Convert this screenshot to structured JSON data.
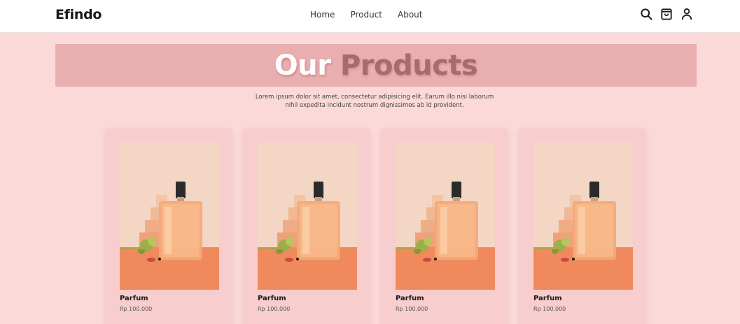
{
  "brand": {
    "name": "Efindo"
  },
  "nav": {
    "links": [
      {
        "label": "Home"
      },
      {
        "label": "Product"
      },
      {
        "label": "About"
      }
    ],
    "icons": [
      "search-icon",
      "bag-icon",
      "user-icon"
    ]
  },
  "hero": {
    "title_part1": "Our",
    "title_part2": "Products",
    "description_line1": "Lorem ipsum dolor sit amet, consectetur adipisicing elit. Earum illo nisi laborum",
    "description_line2": "nihil expedita incidunt nostrum dignissimos ab id provident."
  },
  "products": [
    {
      "name": "Parfum",
      "price": "Rp 100.000"
    },
    {
      "name": "Parfum",
      "price": "Rp 100.000"
    },
    {
      "name": "Parfum",
      "price": "Rp 100.000"
    },
    {
      "name": "Parfum",
      "price": "Rp 100.000"
    }
  ],
  "colors": {
    "page_bg": "#fcd9d9",
    "hero_band": "#e9aeb0",
    "hero_accent": "#a86a6c",
    "card_bg": "#f7cdcd"
  }
}
